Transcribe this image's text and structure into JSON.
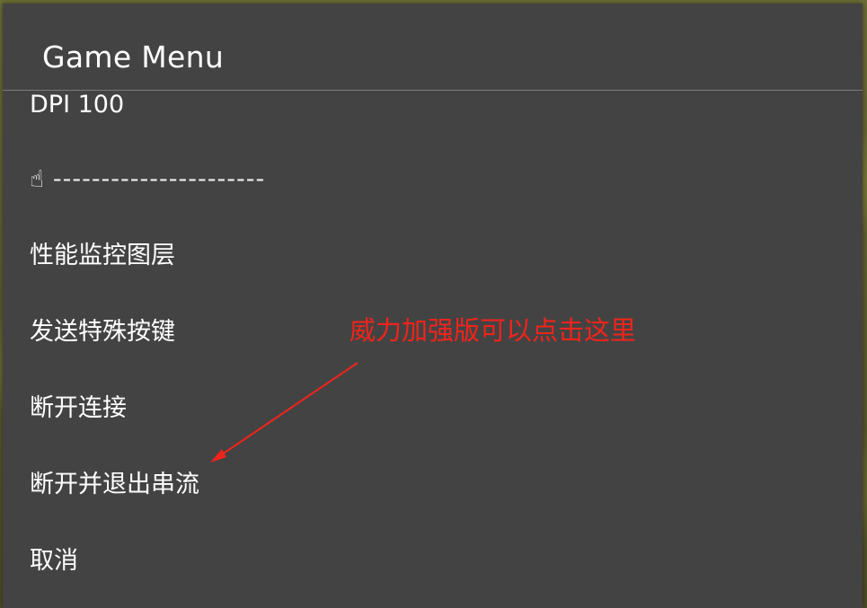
{
  "dialog": {
    "title": "Game Menu"
  },
  "menu": {
    "items": [
      {
        "label": "DPI 100"
      },
      {
        "icon": "pointing-up-hand-icon",
        "glyph": "☝",
        "label": "----------------------"
      },
      {
        "label": "性能监控图层"
      },
      {
        "label": "发送特殊按键"
      },
      {
        "label": "断开连接"
      },
      {
        "label": "断开并退出串流"
      },
      {
        "label": "取消"
      }
    ]
  },
  "annotation": {
    "text": "威力加强版可以点击这里",
    "color": "#f0241b"
  },
  "colors": {
    "dialog_bg": "#434343",
    "text": "#ffffff",
    "divider": "#7d7d7d"
  }
}
